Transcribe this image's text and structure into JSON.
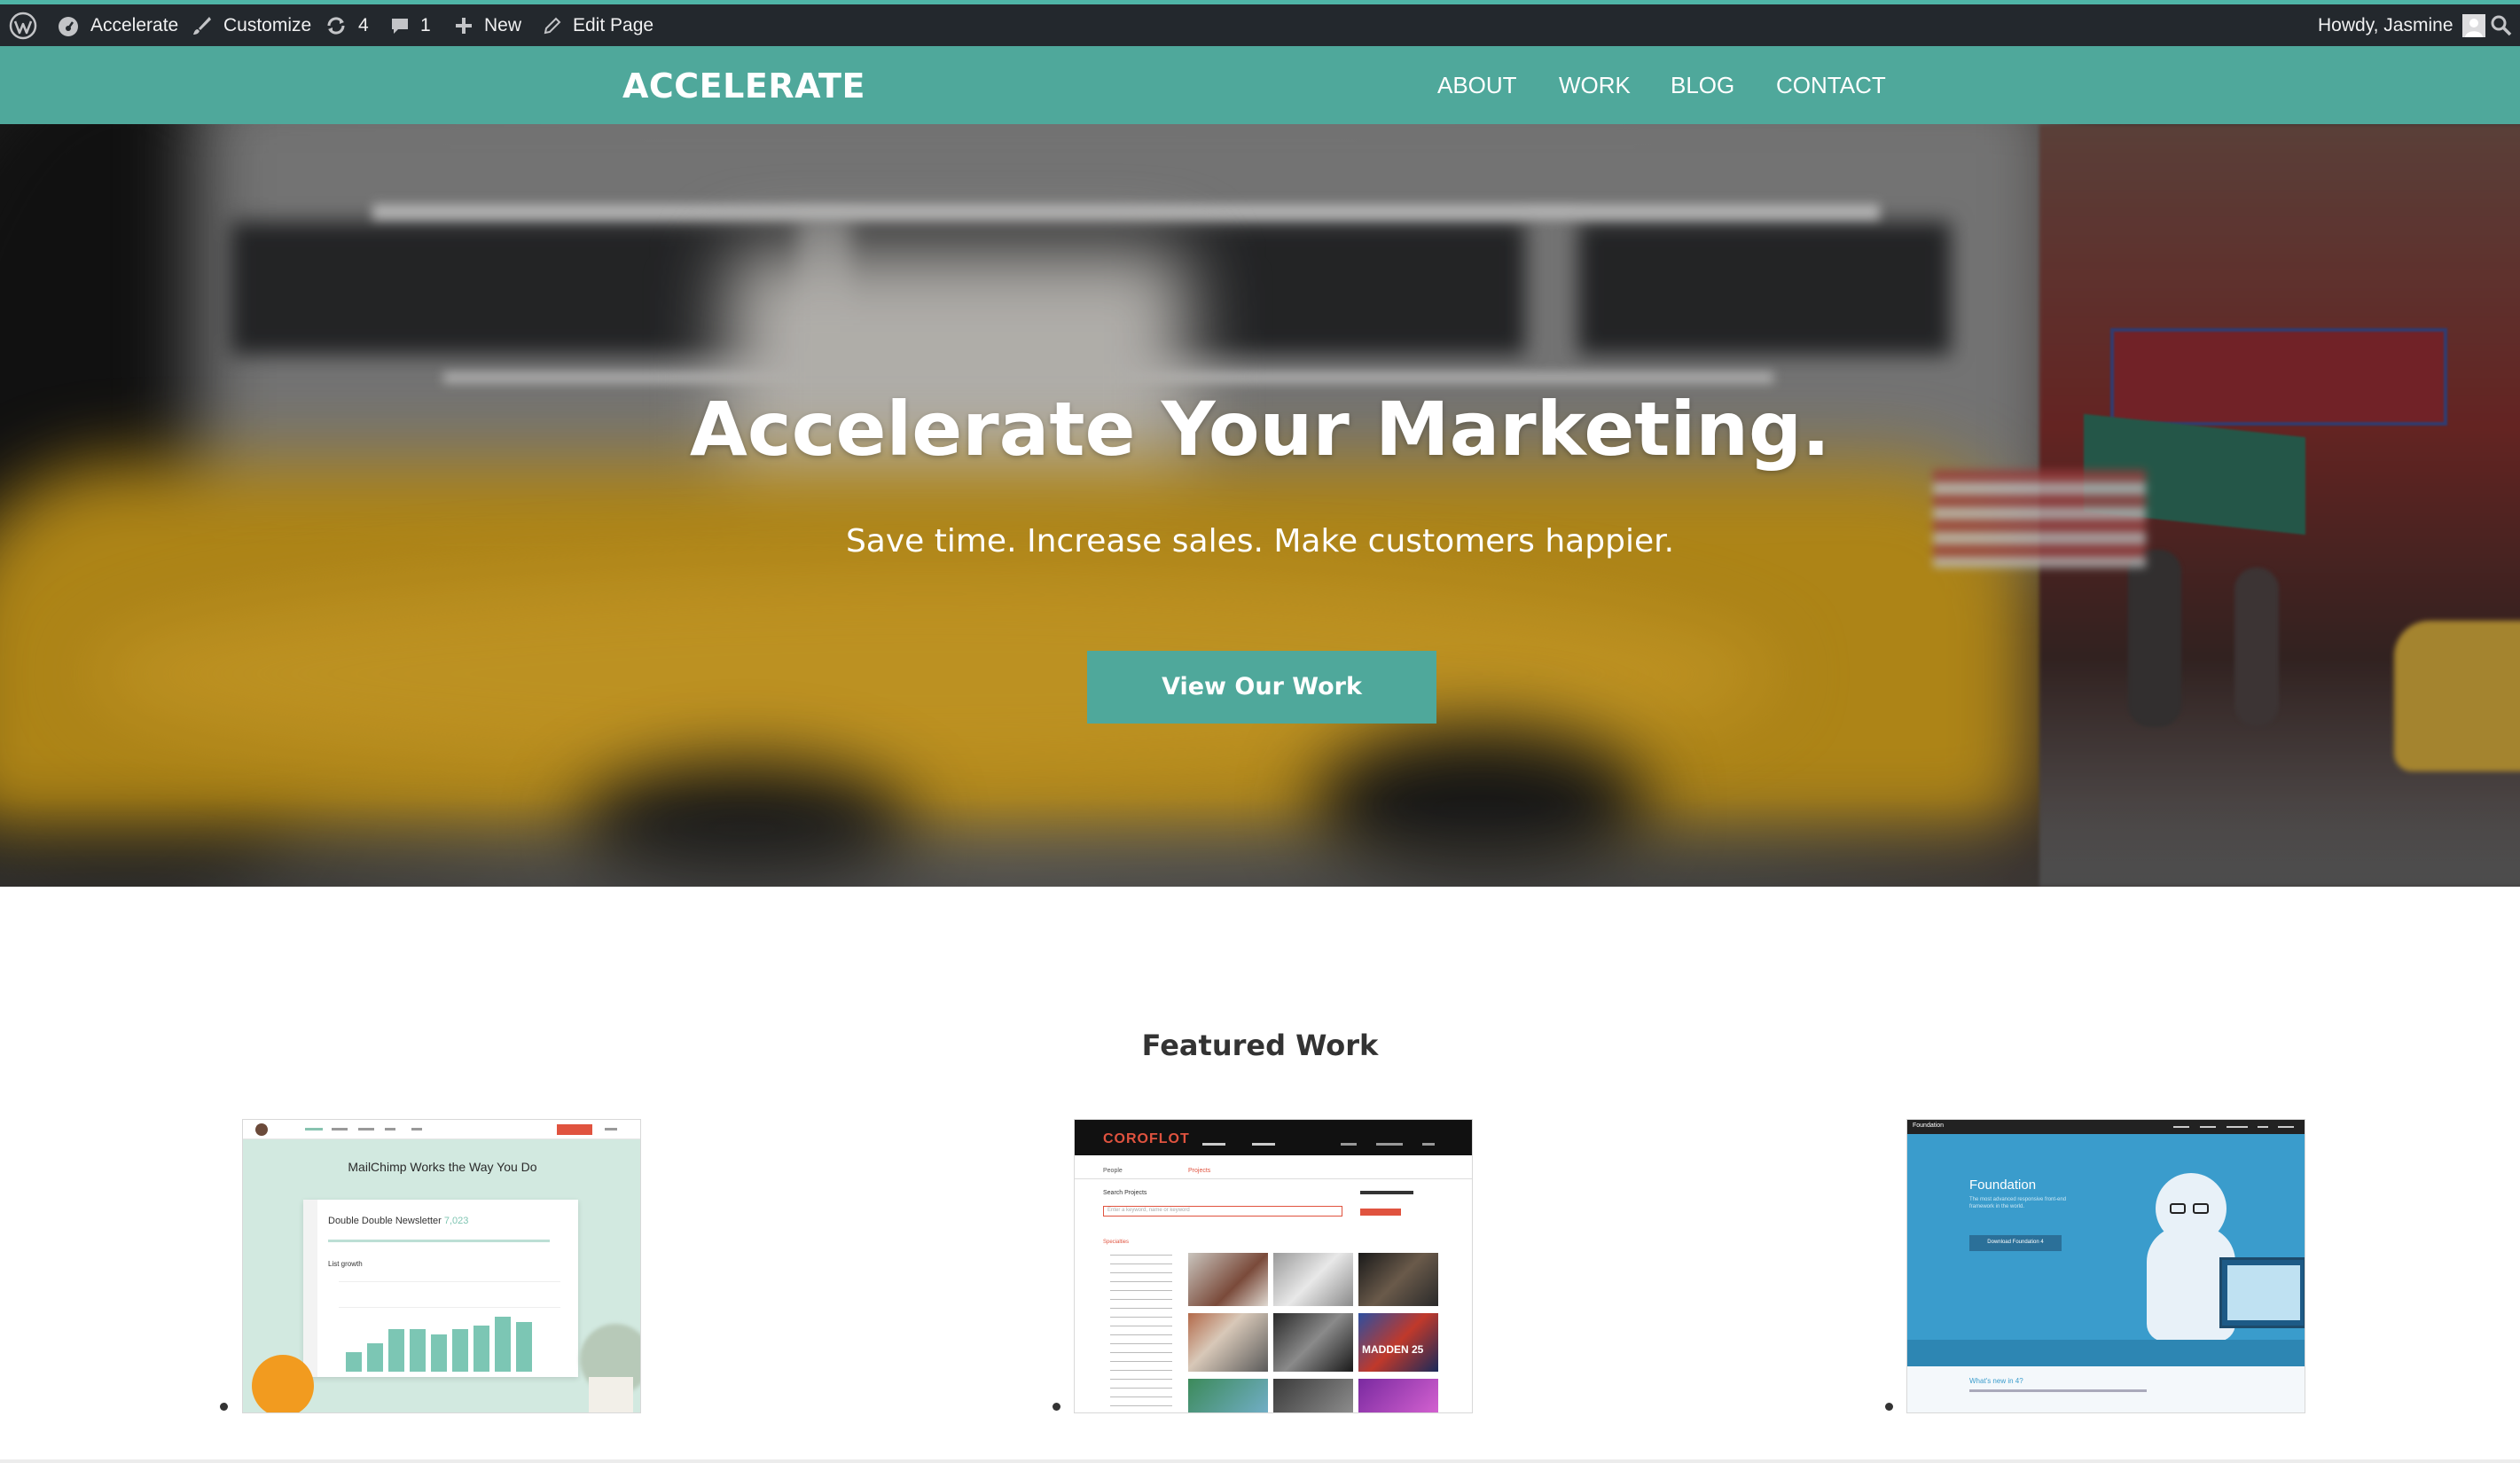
{
  "admin_bar": {
    "site_name": "Accelerate",
    "customize": "Customize",
    "updates_count": "4",
    "comments_count": "1",
    "new_label": "New",
    "edit_page": "Edit Page",
    "howdy": "Howdy, Jasmine"
  },
  "header": {
    "site_title": "ACCELERATE",
    "nav": [
      "ABOUT",
      "WORK",
      "BLOG",
      "CONTACT"
    ],
    "accent_color": "#4fa89b"
  },
  "hero": {
    "title": "Accelerate Your Marketing.",
    "subtitle": "Save time. Increase sales. Make customers happier.",
    "button_label": "View Our Work"
  },
  "featured": {
    "heading": "Featured Work",
    "items": [
      {
        "name": "mailchimp",
        "headline": "MailChimp Works the Way You Do",
        "card_title": "Double Double Newsletter",
        "card_count": "7,023",
        "card_subtitle": "List growth"
      },
      {
        "name": "coroflot",
        "logo": "COROFLOT",
        "tabs": [
          "People",
          "Projects"
        ],
        "search_label": "Search Projects",
        "search_placeholder": "Enter a keyword, name or keyword",
        "specialties_label": "Specialties",
        "game_label": "MADDEN 25"
      },
      {
        "name": "foundation",
        "brand": "Foundation",
        "title": "Foundation",
        "tagline": "The most advanced responsive front-end framework in the world.",
        "button": "Download Foundation 4",
        "footer_text": "What's new in 4?"
      }
    ]
  }
}
